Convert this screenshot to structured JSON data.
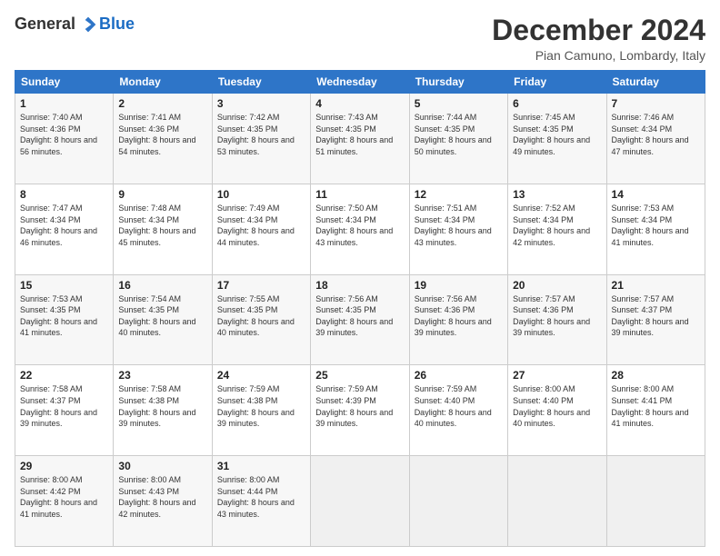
{
  "header": {
    "logo_general": "General",
    "logo_blue": "Blue",
    "title": "December 2024",
    "location": "Pian Camuno, Lombardy, Italy"
  },
  "days_of_week": [
    "Sunday",
    "Monday",
    "Tuesday",
    "Wednesday",
    "Thursday",
    "Friday",
    "Saturday"
  ],
  "weeks": [
    [
      {
        "day": "1",
        "sunrise": "Sunrise: 7:40 AM",
        "sunset": "Sunset: 4:36 PM",
        "daylight": "Daylight: 8 hours and 56 minutes."
      },
      {
        "day": "2",
        "sunrise": "Sunrise: 7:41 AM",
        "sunset": "Sunset: 4:36 PM",
        "daylight": "Daylight: 8 hours and 54 minutes."
      },
      {
        "day": "3",
        "sunrise": "Sunrise: 7:42 AM",
        "sunset": "Sunset: 4:35 PM",
        "daylight": "Daylight: 8 hours and 53 minutes."
      },
      {
        "day": "4",
        "sunrise": "Sunrise: 7:43 AM",
        "sunset": "Sunset: 4:35 PM",
        "daylight": "Daylight: 8 hours and 51 minutes."
      },
      {
        "day": "5",
        "sunrise": "Sunrise: 7:44 AM",
        "sunset": "Sunset: 4:35 PM",
        "daylight": "Daylight: 8 hours and 50 minutes."
      },
      {
        "day": "6",
        "sunrise": "Sunrise: 7:45 AM",
        "sunset": "Sunset: 4:35 PM",
        "daylight": "Daylight: 8 hours and 49 minutes."
      },
      {
        "day": "7",
        "sunrise": "Sunrise: 7:46 AM",
        "sunset": "Sunset: 4:34 PM",
        "daylight": "Daylight: 8 hours and 47 minutes."
      }
    ],
    [
      {
        "day": "8",
        "sunrise": "Sunrise: 7:47 AM",
        "sunset": "Sunset: 4:34 PM",
        "daylight": "Daylight: 8 hours and 46 minutes."
      },
      {
        "day": "9",
        "sunrise": "Sunrise: 7:48 AM",
        "sunset": "Sunset: 4:34 PM",
        "daylight": "Daylight: 8 hours and 45 minutes."
      },
      {
        "day": "10",
        "sunrise": "Sunrise: 7:49 AM",
        "sunset": "Sunset: 4:34 PM",
        "daylight": "Daylight: 8 hours and 44 minutes."
      },
      {
        "day": "11",
        "sunrise": "Sunrise: 7:50 AM",
        "sunset": "Sunset: 4:34 PM",
        "daylight": "Daylight: 8 hours and 43 minutes."
      },
      {
        "day": "12",
        "sunrise": "Sunrise: 7:51 AM",
        "sunset": "Sunset: 4:34 PM",
        "daylight": "Daylight: 8 hours and 43 minutes."
      },
      {
        "day": "13",
        "sunrise": "Sunrise: 7:52 AM",
        "sunset": "Sunset: 4:34 PM",
        "daylight": "Daylight: 8 hours and 42 minutes."
      },
      {
        "day": "14",
        "sunrise": "Sunrise: 7:53 AM",
        "sunset": "Sunset: 4:34 PM",
        "daylight": "Daylight: 8 hours and 41 minutes."
      }
    ],
    [
      {
        "day": "15",
        "sunrise": "Sunrise: 7:53 AM",
        "sunset": "Sunset: 4:35 PM",
        "daylight": "Daylight: 8 hours and 41 minutes."
      },
      {
        "day": "16",
        "sunrise": "Sunrise: 7:54 AM",
        "sunset": "Sunset: 4:35 PM",
        "daylight": "Daylight: 8 hours and 40 minutes."
      },
      {
        "day": "17",
        "sunrise": "Sunrise: 7:55 AM",
        "sunset": "Sunset: 4:35 PM",
        "daylight": "Daylight: 8 hours and 40 minutes."
      },
      {
        "day": "18",
        "sunrise": "Sunrise: 7:56 AM",
        "sunset": "Sunset: 4:35 PM",
        "daylight": "Daylight: 8 hours and 39 minutes."
      },
      {
        "day": "19",
        "sunrise": "Sunrise: 7:56 AM",
        "sunset": "Sunset: 4:36 PM",
        "daylight": "Daylight: 8 hours and 39 minutes."
      },
      {
        "day": "20",
        "sunrise": "Sunrise: 7:57 AM",
        "sunset": "Sunset: 4:36 PM",
        "daylight": "Daylight: 8 hours and 39 minutes."
      },
      {
        "day": "21",
        "sunrise": "Sunrise: 7:57 AM",
        "sunset": "Sunset: 4:37 PM",
        "daylight": "Daylight: 8 hours and 39 minutes."
      }
    ],
    [
      {
        "day": "22",
        "sunrise": "Sunrise: 7:58 AM",
        "sunset": "Sunset: 4:37 PM",
        "daylight": "Daylight: 8 hours and 39 minutes."
      },
      {
        "day": "23",
        "sunrise": "Sunrise: 7:58 AM",
        "sunset": "Sunset: 4:38 PM",
        "daylight": "Daylight: 8 hours and 39 minutes."
      },
      {
        "day": "24",
        "sunrise": "Sunrise: 7:59 AM",
        "sunset": "Sunset: 4:38 PM",
        "daylight": "Daylight: 8 hours and 39 minutes."
      },
      {
        "day": "25",
        "sunrise": "Sunrise: 7:59 AM",
        "sunset": "Sunset: 4:39 PM",
        "daylight": "Daylight: 8 hours and 39 minutes."
      },
      {
        "day": "26",
        "sunrise": "Sunrise: 7:59 AM",
        "sunset": "Sunset: 4:40 PM",
        "daylight": "Daylight: 8 hours and 40 minutes."
      },
      {
        "day": "27",
        "sunrise": "Sunrise: 8:00 AM",
        "sunset": "Sunset: 4:40 PM",
        "daylight": "Daylight: 8 hours and 40 minutes."
      },
      {
        "day": "28",
        "sunrise": "Sunrise: 8:00 AM",
        "sunset": "Sunset: 4:41 PM",
        "daylight": "Daylight: 8 hours and 41 minutes."
      }
    ],
    [
      {
        "day": "29",
        "sunrise": "Sunrise: 8:00 AM",
        "sunset": "Sunset: 4:42 PM",
        "daylight": "Daylight: 8 hours and 41 minutes."
      },
      {
        "day": "30",
        "sunrise": "Sunrise: 8:00 AM",
        "sunset": "Sunset: 4:43 PM",
        "daylight": "Daylight: 8 hours and 42 minutes."
      },
      {
        "day": "31",
        "sunrise": "Sunrise: 8:00 AM",
        "sunset": "Sunset: 4:44 PM",
        "daylight": "Daylight: 8 hours and 43 minutes."
      },
      null,
      null,
      null,
      null
    ]
  ]
}
